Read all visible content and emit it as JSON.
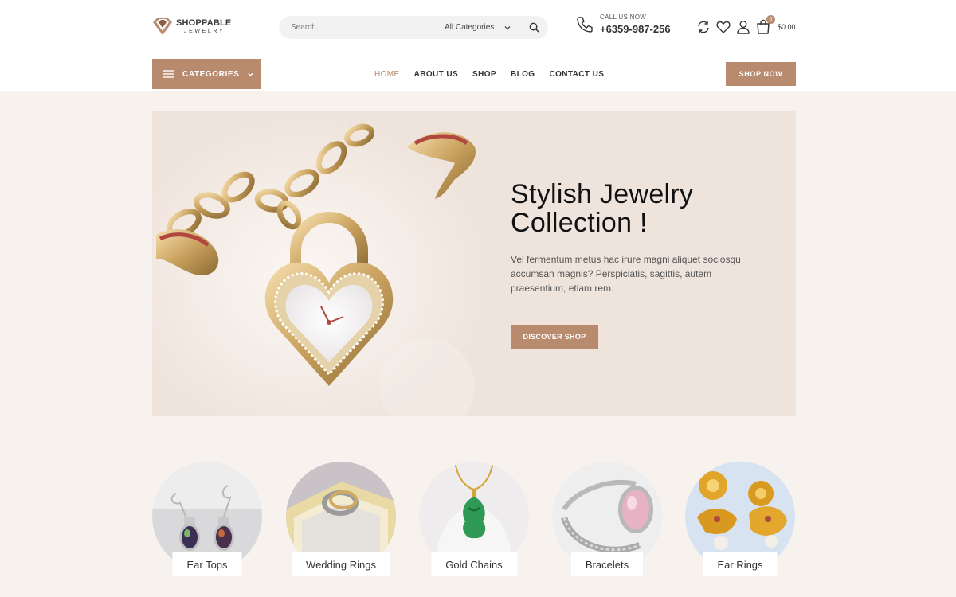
{
  "brand": {
    "name": "SHOPPABLE",
    "tagline": "JEWELRY"
  },
  "search": {
    "placeholder": "Search...",
    "category": "All Categories"
  },
  "contact": {
    "label": "CALL US NOW",
    "phone": "+6359-987-256"
  },
  "cart": {
    "count": "0",
    "total": "$0.00"
  },
  "nav": {
    "categories_label": "CATEGORIES",
    "items": [
      {
        "label": "HOME",
        "active": true
      },
      {
        "label": "ABOUT US"
      },
      {
        "label": "SHOP"
      },
      {
        "label": "BLOG"
      },
      {
        "label": "CONTACT US"
      }
    ],
    "cta": "SHOP NOW"
  },
  "hero": {
    "title_line1": "Stylish Jewelry",
    "title_line2": "Collection !",
    "description": "Vel fermentum metus hac irure magni aliquet sociosqu accumsan magnis? Perspiciatis, sagittis, autem praesentium, etiam rem.",
    "button": "DISCOVER SHOP"
  },
  "categories": [
    {
      "label": "Ear Tops"
    },
    {
      "label": "Wedding Rings"
    },
    {
      "label": "Gold Chains"
    },
    {
      "label": "Bracelets"
    },
    {
      "label": "Ear Rings"
    }
  ],
  "colors": {
    "accent": "#b88a6e",
    "background": "#f7f2ee",
    "hero_bg": "#efe4dc"
  }
}
